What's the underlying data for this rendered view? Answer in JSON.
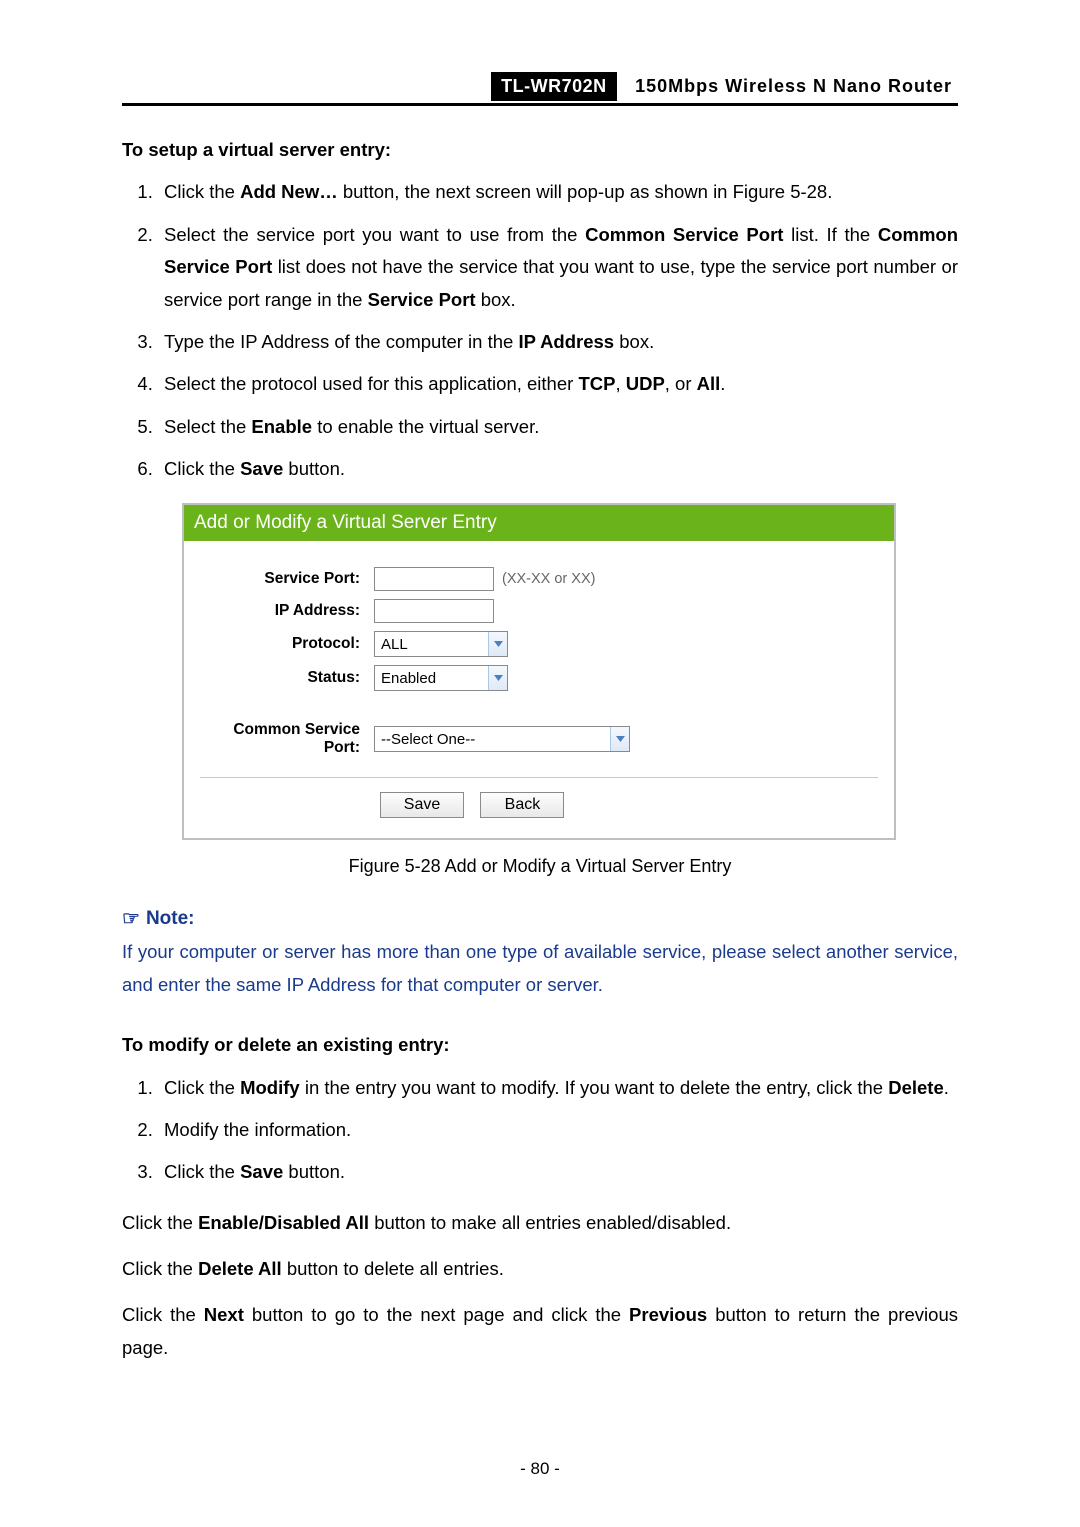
{
  "header": {
    "model": "TL-WR702N",
    "desc": "150Mbps Wireless N Nano Router"
  },
  "section1_title": "To setup a virtual server entry:",
  "steps1": {
    "s1_a": "Click the ",
    "s1_b": "Add New…",
    "s1_c": " button, the next screen will pop-up as shown in Figure 5-28.",
    "s2_a": "Select the service port you want to use from the ",
    "s2_b": "Common Service Port",
    "s2_c": " list. If the ",
    "s2_d": "Common Service Port",
    "s2_e": " list does not have the service that you want to use, type the service port number or service port range in the ",
    "s2_f": "Service Port",
    "s2_g": " box.",
    "s3_a": "Type the IP Address of the computer in the ",
    "s3_b": "IP Address",
    "s3_c": " box.",
    "s4_a": "Select the protocol used for this application, either ",
    "s4_b": "TCP",
    "s4_c": ", ",
    "s4_d": "UDP",
    "s4_e": ", or ",
    "s4_f": "All",
    "s4_g": ".",
    "s5_a": "Select the ",
    "s5_b": "Enable",
    "s5_c": " to enable the virtual server.",
    "s6_a": "Click the ",
    "s6_b": "Save",
    "s6_c": " button."
  },
  "figure": {
    "title": "Add or Modify a Virtual Server Entry",
    "labels": {
      "service_port": "Service Port:",
      "ip_address": "IP Address:",
      "protocol": "Protocol:",
      "status": "Status:",
      "common_service_port": "Common Service Port:"
    },
    "hint": "(XX-XX or XX)",
    "values": {
      "protocol": "ALL",
      "status": "Enabled",
      "common_service_port": "--Select One--"
    },
    "buttons": {
      "save": "Save",
      "back": "Back"
    }
  },
  "figure_caption": "Figure 5-28    Add or Modify a Virtual Server Entry",
  "note": {
    "heading": "Note:",
    "body": "If your computer or server has more than one type of available service, please select another service, and enter the same IP Address for that computer or server."
  },
  "section2_title": "To modify or delete an existing entry:",
  "steps2": {
    "s1_a": "Click the ",
    "s1_b": "Modify",
    "s1_c": " in the entry you want to modify. If you want to delete the entry, click the ",
    "s1_d": "Delete",
    "s1_e": ".",
    "s2": "Modify the information.",
    "s3_a": "Click the ",
    "s3_b": "Save",
    "s3_c": " button."
  },
  "paras": {
    "p1_a": "Click the ",
    "p1_b": "Enable/Disabled All",
    "p1_c": " button to make all entries enabled/disabled.",
    "p2_a": "Click the ",
    "p2_b": "Delete All",
    "p2_c": " button to delete all entries.",
    "p3_a": "Click the ",
    "p3_b": "Next",
    "p3_c": " button to go to the next page and click the ",
    "p3_d": "Previous",
    "p3_e": " button to return the previous page."
  },
  "page_number": "- 80 -"
}
